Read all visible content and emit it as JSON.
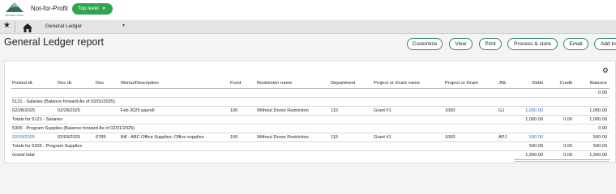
{
  "header": {
    "logo_text": "MINDEN PEAK",
    "company": "Not-for-Profit",
    "level_label": "Top level"
  },
  "nav": {
    "title": "General Ledger"
  },
  "page": {
    "title": "General Ledger report",
    "buttons": [
      "Customize",
      "View",
      "Print",
      "Process & store",
      "Email",
      "Add to"
    ]
  },
  "table": {
    "columns": [
      "Posted dt.",
      "Doc dt.",
      "Doc",
      "Memo/Description",
      "Fund",
      "Restriction name",
      "Department",
      "Project or Grant name",
      "Project or Grant",
      "JNL",
      "Debit",
      "Credit",
      "Balance"
    ],
    "rows": [
      {
        "type": "balance",
        "text": "",
        "balance": "0.00"
      },
      {
        "type": "group",
        "text": "5121 - Salaries (Balance forward As of 02/01/2025)"
      },
      {
        "type": "data",
        "posted": "02/28/2025",
        "doc_dt": "02/28/2025",
        "doc": "",
        "memo": "Feb 2025 payroll",
        "fund": "100",
        "restriction": "Without Donor Restriction",
        "department": "110",
        "grant_name": "Grant #1",
        "grant": "1000",
        "jnl": "GJ",
        "debit": "1,000.00",
        "credit": "",
        "balance": "1,000.00",
        "posted_link": false
      },
      {
        "type": "total",
        "text": "Totals for 5121 - Salaries",
        "debit": "1,000.00",
        "credit": "0.00",
        "balance": "1,000.00"
      },
      {
        "type": "balance",
        "text": "5305 - Program Supplies (Balance forward As of 02/01/2025)",
        "balance": "0.00"
      },
      {
        "type": "data",
        "posted": "02/03/2025",
        "doc_dt": "02/03/2025",
        "doc": "6789",
        "memo": "Bill - ABC Office Supplies: Office supplies",
        "fund": "100",
        "restriction": "Without Donor Restriction",
        "department": "110",
        "grant_name": "Grant #1",
        "grant": "1000",
        "jnl": "APJ",
        "debit": "500.00",
        "credit": "",
        "balance": "500.00",
        "posted_link": true
      },
      {
        "type": "total",
        "text": "Totals for 5305 - Program Supplies",
        "debit": "500.00",
        "credit": "0.00",
        "balance": "500.00"
      },
      {
        "type": "grand",
        "text": "Grand total",
        "debit": "1,500.00",
        "credit": "0.00",
        "balance": "1,500.00"
      }
    ]
  },
  "colors": {
    "accent": "#2ea44f",
    "link": "#2a6fc9"
  }
}
